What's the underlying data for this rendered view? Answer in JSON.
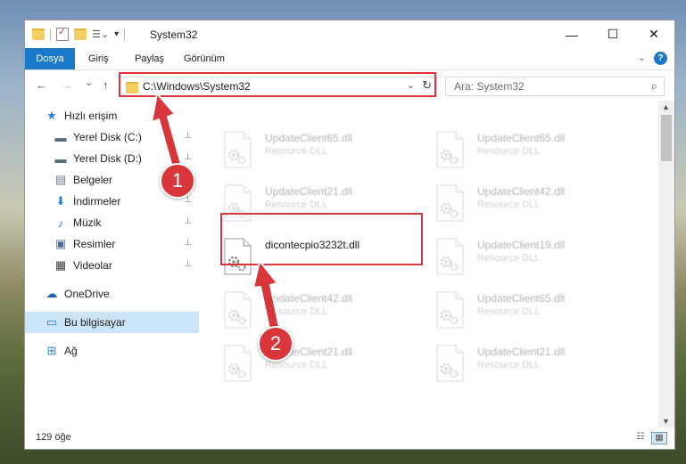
{
  "window": {
    "title": "System32",
    "controls": {
      "minimize": "—",
      "maximize": "☐",
      "close": "✕"
    }
  },
  "ribbon": {
    "tabs": [
      "Dosya",
      "Giriş",
      "Paylaş",
      "Görünüm"
    ],
    "expand_icon": "chevron-down-icon",
    "help": "?"
  },
  "nav": {
    "back": "←",
    "forward": "→",
    "recent": "⌄",
    "up": "↑",
    "address": "C:\\Windows\\System32",
    "address_dropdown": "⌄",
    "refresh": "↻",
    "search_placeholder": "Ara: System32",
    "search_icon": "⌕"
  },
  "sidebar": {
    "items": [
      {
        "label": "Hızlı erişim",
        "icon": "star-icon",
        "glyph": "★",
        "color": "#2b7cd3",
        "pinned": false
      },
      {
        "label": "Yerel Disk (C:)",
        "icon": "drive-icon",
        "glyph": "▬",
        "color": "#5b6d7c",
        "pinned": true
      },
      {
        "label": "Yerel Disk (D:)",
        "icon": "drive-icon",
        "glyph": "▬",
        "color": "#5b6d7c",
        "pinned": true
      },
      {
        "label": "Belgeler",
        "icon": "document-icon",
        "glyph": "▤",
        "color": "#6b7b8c",
        "pinned": true
      },
      {
        "label": "İndirmeler",
        "icon": "download-icon",
        "glyph": "⬇",
        "color": "#2b7cd3",
        "pinned": true
      },
      {
        "label": "Müzik",
        "icon": "music-icon",
        "glyph": "♪",
        "color": "#2b7cd3",
        "pinned": true
      },
      {
        "label": "Resimler",
        "icon": "pictures-icon",
        "glyph": "▣",
        "color": "#4c6e94",
        "pinned": true
      },
      {
        "label": "Videolar",
        "icon": "video-icon",
        "glyph": "▦",
        "color": "#3b3b3b",
        "pinned": true
      },
      {
        "label": "OneDrive",
        "icon": "cloud-icon",
        "glyph": "☁",
        "color": "#1e63b8",
        "pinned": false
      },
      {
        "label": "Bu bilgisayar",
        "icon": "computer-icon",
        "glyph": "▭",
        "color": "#2b7cd3",
        "pinned": false
      },
      {
        "label": "Ağ",
        "icon": "network-icon",
        "glyph": "⊞",
        "color": "#2b7cd3",
        "pinned": false
      }
    ],
    "pin_glyph": "📌"
  },
  "files": [
    {
      "name": "UpdateClient65.dll",
      "type": "Resource DLL",
      "blurred": true
    },
    {
      "name": "UpdateClient65.dll",
      "type": "Resource DLL",
      "blurred": true
    },
    {
      "name": "UpdateClient21.dll",
      "type": "Resource DLL",
      "blurred": true
    },
    {
      "name": "UpdateClient42.dll",
      "type": "Resource DLL",
      "blurred": true
    },
    {
      "name": "dicontecpio3232t.dll",
      "type": "",
      "blurred": false
    },
    {
      "name": "UpdateClient19.dll",
      "type": "Resource DLL",
      "blurred": true
    },
    {
      "name": "UpdateClient42.dll",
      "type": "Resource DLL",
      "blurred": true
    },
    {
      "name": "UpdateClient65.dll",
      "type": "Resource DLL",
      "blurred": true
    },
    {
      "name": "UpdateClient21.dll",
      "type": "Resource DLL",
      "blurred": true
    },
    {
      "name": "UpdateClient21.dll",
      "type": "Resource DLL",
      "blurred": true
    }
  ],
  "status": {
    "count": "129 öğe"
  },
  "annotations": {
    "step1": "1",
    "step2": "2",
    "highlight_color": "#d8363a"
  }
}
